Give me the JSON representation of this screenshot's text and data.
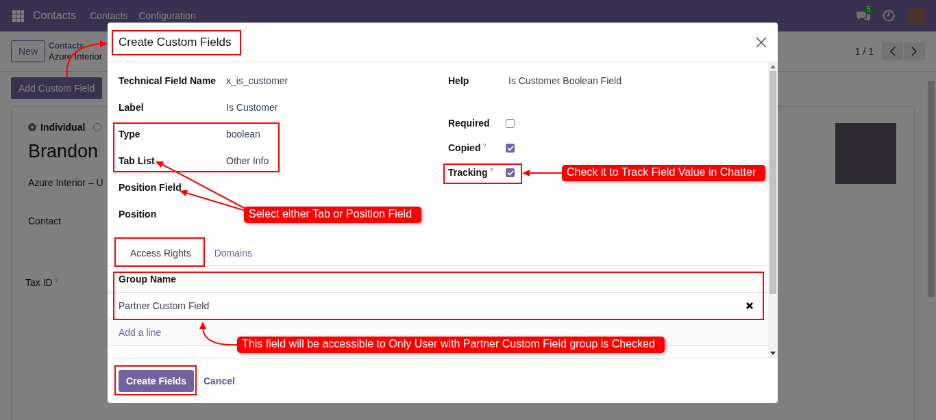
{
  "navbar": {
    "app_name": "Contacts",
    "menu": [
      "Contacts",
      "Configuration"
    ],
    "messages_count": "5"
  },
  "control_panel": {
    "new_button": "New",
    "breadcrumb": [
      "Contacts",
      "Azure Interior"
    ],
    "pager": "1 / 1"
  },
  "action_button": "Add Custom Field",
  "form": {
    "radios": [
      {
        "label": "Individual",
        "selected": true
      },
      {
        "selected": false
      }
    ],
    "name": "Brandon",
    "company_line": "Azure Interior – U",
    "fields": [
      {
        "label": "Contact"
      },
      {
        "label": "Tax ID",
        "help": "?"
      }
    ]
  },
  "dialog": {
    "title": "Create Custom Fields",
    "left_fields": [
      {
        "label": "Technical Field Name",
        "value": "x_is_customer"
      },
      {
        "label": "Label",
        "value": "Is Customer"
      },
      {
        "label": "Type",
        "value": "boolean"
      },
      {
        "label": "Tab List",
        "value": "Other Info"
      },
      {
        "label": "Position Field"
      },
      {
        "label": "Position"
      }
    ],
    "right_fields": [
      {
        "kind": "text",
        "label": "Help",
        "value": "Is Customer Boolean Field"
      },
      {
        "kind": "checkbox",
        "label": "Required",
        "checked": false
      },
      {
        "kind": "checkbox",
        "label": "Copied",
        "help": "?",
        "checked": true
      },
      {
        "kind": "checkbox",
        "label": "Tracking",
        "help": "?",
        "checked": true
      }
    ],
    "tabs": [
      {
        "label": "Access Rights",
        "selected": true
      },
      {
        "label": "Domains",
        "selected": false
      }
    ],
    "table": {
      "columns": [
        "Group Name"
      ],
      "rows": [
        [
          "Partner Custom Field"
        ]
      ],
      "add_line": "Add a line"
    },
    "buttons": [
      {
        "kind": "primary",
        "label": "Create Fields"
      },
      {
        "kind": "link",
        "label": "Cancel"
      }
    ]
  },
  "annotations": [
    {
      "text": "Check it to Track Field Value in Chatter"
    },
    {
      "text": "Select either Tab or Position Field"
    },
    {
      "text": "This field will be accessible to Only User with Partner Custom Field group is Checked"
    }
  ]
}
